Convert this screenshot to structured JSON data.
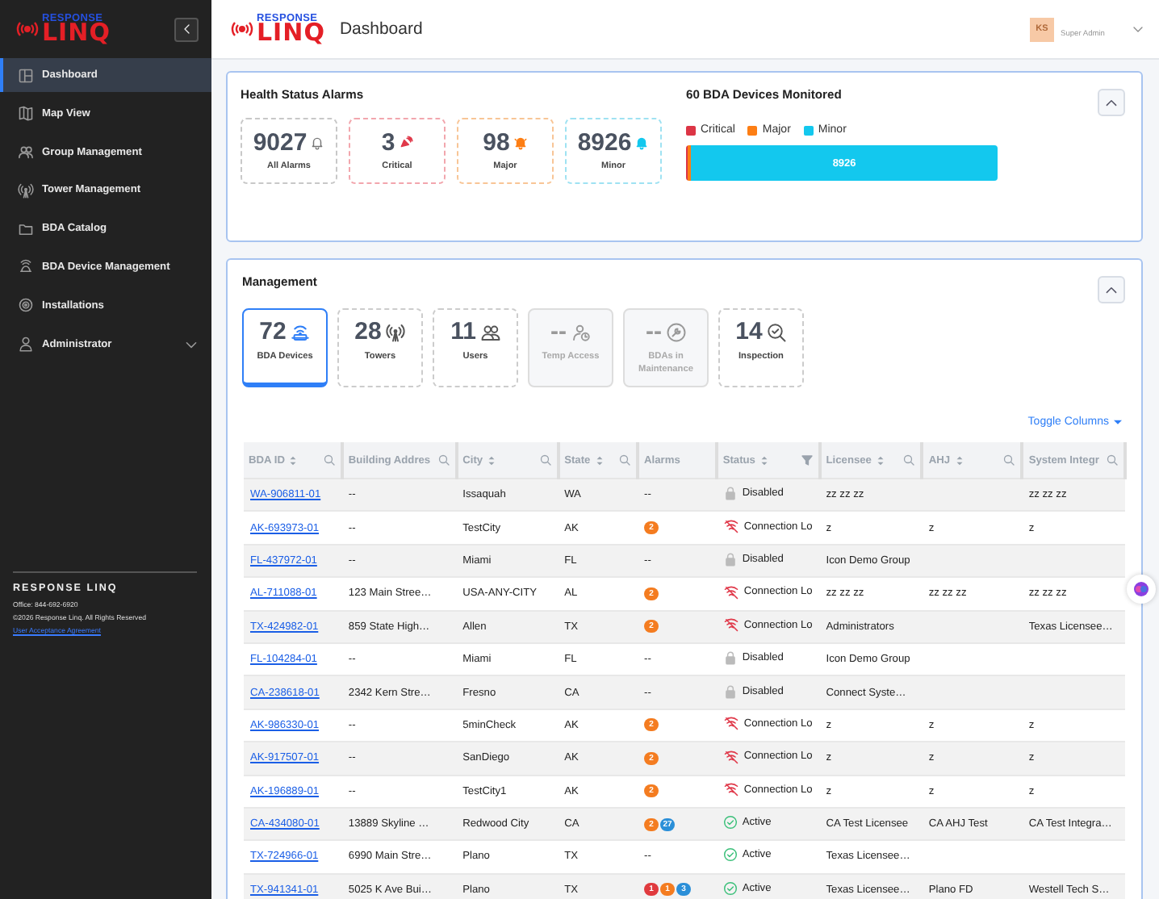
{
  "sidebar": {
    "logo": {
      "top": "RESPONSE",
      "bottom": "LINQ"
    },
    "items": [
      {
        "label": "Dashboard",
        "kind": "dashboard",
        "selected": true
      },
      {
        "label": "Map View",
        "kind": "map",
        "selected": false
      },
      {
        "label": "Group Management",
        "kind": "group",
        "selected": false
      },
      {
        "label": "Tower Management",
        "kind": "tower",
        "selected": false
      },
      {
        "label": "BDA Catalog",
        "kind": "folder",
        "selected": false
      },
      {
        "label": "BDA Device Management",
        "kind": "device",
        "selected": false
      },
      {
        "label": "Installations",
        "kind": "install",
        "selected": false
      },
      {
        "label": "Administrator",
        "kind": "admin",
        "selected": false,
        "expanded": false
      }
    ],
    "footer": {
      "brand": "RESPONSE LINQ",
      "office": "Office: 844-692-6920",
      "copyright": "©2026 Response Linq. All Rights Reserved",
      "link": "User Acceptance Agreement"
    }
  },
  "header": {
    "logo": {
      "top": "RESPONSE",
      "bottom": "LINQ"
    },
    "title": "Dashboard",
    "user": {
      "initials": "KS",
      "role": "Super Admin"
    }
  },
  "health": {
    "title": "Health Status Alarms",
    "expanded": true,
    "tiles": [
      {
        "count": "9027",
        "label": "All Alarms",
        "kind": "all"
      },
      {
        "count": "3",
        "label": "Critical",
        "kind": "critical"
      },
      {
        "count": "98",
        "label": "Major",
        "kind": "major"
      },
      {
        "count": "8926",
        "label": "Minor",
        "kind": "minor"
      }
    ],
    "devices_title": "60 BDA Devices Monitored",
    "legend": [
      {
        "label": "Critical",
        "color": "#dc3545",
        "level": 0.0003
      },
      {
        "label": "Major",
        "color": "#fd7e14",
        "level": 0.011
      },
      {
        "label": "Minor",
        "color": "#13c8ee",
        "level": 0.9887,
        "reading": "8926"
      }
    ]
  },
  "management": {
    "title": "Management",
    "expanded": true,
    "tiles": [
      {
        "count": "72",
        "label": "BDA Devices",
        "kind": "bda",
        "selected": true,
        "disabled": false
      },
      {
        "count": "28",
        "label": "Towers",
        "kind": "tower",
        "selected": false,
        "disabled": false
      },
      {
        "count": "11",
        "label": "Users",
        "kind": "users",
        "selected": false,
        "disabled": false
      },
      {
        "count": "--",
        "label": "Temp Access",
        "kind": "temp",
        "selected": false,
        "disabled": true
      },
      {
        "count": "--",
        "label": "BDAs in Maintenance",
        "kind": "wrench",
        "selected": false,
        "disabled": true
      },
      {
        "count": "14",
        "label": "Inspection",
        "kind": "inspect",
        "selected": false,
        "disabled": false
      }
    ],
    "toggle_columns": "Toggle Columns",
    "table": {
      "columns": [
        {
          "label": "BDA ID",
          "sortable": true,
          "searchable": true,
          "filterable": false
        },
        {
          "label": "Building Addres",
          "sortable": false,
          "searchable": true,
          "filterable": false
        },
        {
          "label": "City",
          "sortable": true,
          "searchable": true,
          "filterable": false
        },
        {
          "label": "State",
          "sortable": true,
          "searchable": true,
          "filterable": false
        },
        {
          "label": "Alarms",
          "sortable": false,
          "searchable": false,
          "filterable": false
        },
        {
          "label": "Status",
          "sortable": true,
          "searchable": false,
          "filterable": true
        },
        {
          "label": "Licensee",
          "sortable": true,
          "searchable": true,
          "filterable": false
        },
        {
          "label": "AHJ",
          "sortable": true,
          "searchable": true,
          "filterable": false
        },
        {
          "label": "System Integr",
          "sortable": false,
          "searchable": true,
          "filterable": false
        }
      ],
      "rows": [
        {
          "id": "WA-906811-01",
          "address": "--",
          "city": "Issaquah",
          "state": "WA",
          "alarms": "--",
          "status": {
            "kind": "disabled",
            "label": "Disabled"
          },
          "licensee": "zz zz zz",
          "integrator": "zz zz zz"
        },
        {
          "id": "AK-693973-01",
          "address": "--",
          "city": "TestCity",
          "state": "AK",
          "alarms": [
            {
              "count": "2",
              "color": "#f47c20"
            }
          ],
          "status": {
            "kind": "lost",
            "label": "Connection Lo"
          },
          "licensee": "z",
          "ahj": "z",
          "integrator": "z"
        },
        {
          "id": "FL-437972-01",
          "address": "--",
          "city": "Miami",
          "state": "FL",
          "alarms": "--",
          "status": {
            "kind": "disabled",
            "label": "Disabled"
          },
          "licensee": "Icon Demo Group"
        },
        {
          "id": "AL-711088-01",
          "address": "123 Main Stree…",
          "city": "USA-ANY-CITY",
          "state": "AL",
          "alarms": [
            {
              "count": "2",
              "color": "#f47c20"
            }
          ],
          "status": {
            "kind": "lost",
            "label": "Connection Lo"
          },
          "licensee": "zz zz zz",
          "ahj": "zz zz zz",
          "integrator": "zz zz zz"
        },
        {
          "id": "TX-424982-01",
          "address": "859 State High…",
          "city": "Allen",
          "state": "TX",
          "alarms": [
            {
              "count": "2",
              "color": "#f47c20"
            }
          ],
          "status": {
            "kind": "lost",
            "label": "Connection Lo"
          },
          "licensee": "Administrators",
          "integrator": "Texas Licensee…"
        },
        {
          "id": "FL-104284-01",
          "address": "--",
          "city": "Miami",
          "state": "FL",
          "alarms": "--",
          "status": {
            "kind": "disabled",
            "label": "Disabled"
          },
          "licensee": "Icon Demo Group"
        },
        {
          "id": "CA-238618-01",
          "address": "2342 Kern Stre…",
          "city": "Fresno",
          "state": "CA",
          "alarms": "--",
          "status": {
            "kind": "disabled",
            "label": "Disabled"
          },
          "licensee": "Connect Syste…"
        },
        {
          "id": "AK-986330-01",
          "address": "--",
          "city": "5minCheck",
          "state": "AK",
          "alarms": [
            {
              "count": "2",
              "color": "#f47c20"
            }
          ],
          "status": {
            "kind": "lost",
            "label": "Connection Lo"
          },
          "licensee": "z",
          "ahj": "z",
          "integrator": "z"
        },
        {
          "id": "AK-917507-01",
          "address": "--",
          "city": "SanDiego",
          "state": "AK",
          "alarms": [
            {
              "count": "2",
              "color": "#f47c20"
            }
          ],
          "status": {
            "kind": "lost",
            "label": "Connection Lo"
          },
          "licensee": "z",
          "ahj": "z",
          "integrator": "z"
        },
        {
          "id": "AK-196889-01",
          "address": "--",
          "city": "TestCity1",
          "state": "AK",
          "alarms": [
            {
              "count": "2",
              "color": "#f47c20"
            }
          ],
          "status": {
            "kind": "lost",
            "label": "Connection Lo"
          },
          "licensee": "z",
          "ahj": "z",
          "integrator": "z"
        },
        {
          "id": "CA-434080-01",
          "address": "13889 Skyline …",
          "city": "Redwood City",
          "state": "CA",
          "alarms": [
            {
              "count": "2",
              "color": "#f47c20"
            },
            {
              "count": "27",
              "color": "#2b8fd8"
            }
          ],
          "status": {
            "kind": "active",
            "label": "Active"
          },
          "licensee": "CA Test Licensee",
          "ahj": "CA AHJ Test",
          "integrator": "CA Test Integra…"
        },
        {
          "id": "TX-724966-01",
          "address": "6990 Main Stre…",
          "city": "Plano",
          "state": "TX",
          "alarms": "--",
          "status": {
            "kind": "active",
            "label": "Active"
          },
          "licensee": "Texas Licensee…"
        },
        {
          "id": "TX-941341-01",
          "address": "5025 K Ave Bui…",
          "city": "Plano",
          "state": "TX",
          "alarms": [
            {
              "count": "1",
              "color": "#e03a3e"
            },
            {
              "count": "1",
              "color": "#f47c20"
            },
            {
              "count": "3",
              "color": "#2b8fd8"
            }
          ],
          "status": {
            "kind": "active",
            "label": "Active"
          },
          "licensee": "Texas Licensee…",
          "ahj": "Plano FD",
          "integrator": "Westell Tech S…"
        }
      ]
    }
  }
}
